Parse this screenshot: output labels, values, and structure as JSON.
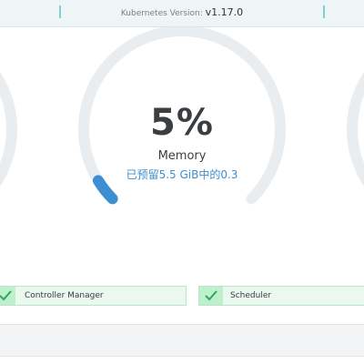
{
  "header": {
    "version_label": "Kubernetes Version:",
    "version_value": "v1.17.0"
  },
  "gauges": {
    "center": {
      "percent_text": "5%",
      "label": "Memory",
      "detail": "已预留5.5 GiB中的0.3",
      "fill_fraction": 0.05,
      "track_color": "#e9edf0",
      "fill_color": "#3d8fd1"
    }
  },
  "status": {
    "items": [
      {
        "label": "Controller Manager",
        "icon": "check-icon",
        "state": "healthy"
      },
      {
        "label": "Scheduler",
        "icon": "check-icon",
        "state": "healthy"
      }
    ],
    "healthy_color": "#2fa85a"
  }
}
